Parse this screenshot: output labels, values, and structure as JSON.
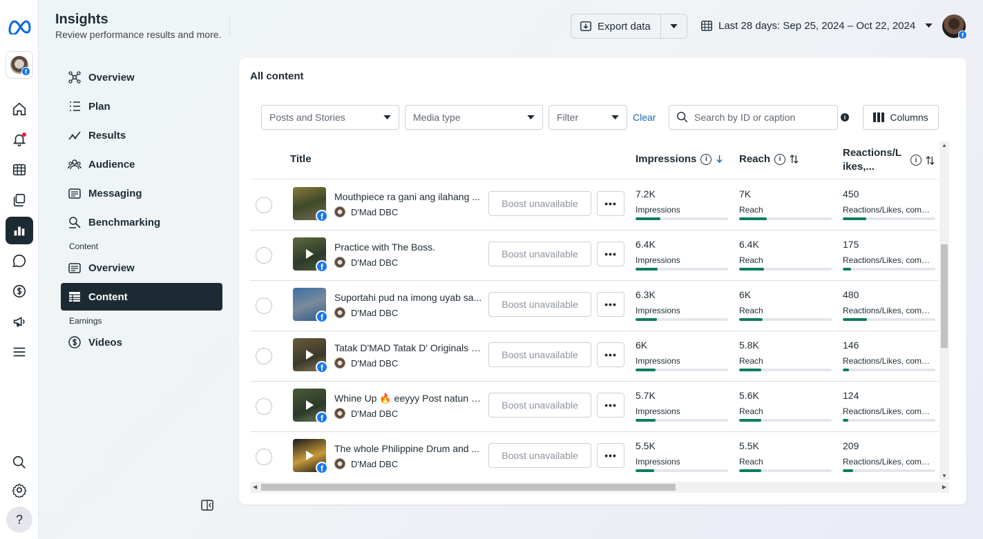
{
  "header": {
    "title": "Insights",
    "subtitle": "Review performance results and more."
  },
  "toolbar": {
    "export_label": "Export data",
    "date_range": "Last 28 days: Sep 25, 2024 – Oct 22, 2024"
  },
  "nav": {
    "items": [
      {
        "label": "Overview",
        "icon": "network-icon"
      },
      {
        "label": "Plan",
        "icon": "list-icon"
      },
      {
        "label": "Results",
        "icon": "trend-icon"
      },
      {
        "label": "Audience",
        "icon": "people-icon"
      },
      {
        "label": "Messaging",
        "icon": "messaging-icon"
      },
      {
        "label": "Benchmarking",
        "icon": "benchmark-icon"
      }
    ],
    "content_section": "Content",
    "content_items": [
      {
        "label": "Overview"
      },
      {
        "label": "Content"
      }
    ],
    "earnings_section": "Earnings",
    "earnings_items": [
      {
        "label": "Videos"
      }
    ]
  },
  "card": {
    "title": "All content",
    "filters": {
      "posts_dropdown": "Posts and Stories",
      "media_dropdown": "Media type",
      "filter_dropdown": "Filter",
      "clear": "Clear",
      "search_placeholder": "Search by ID or caption",
      "columns": "Columns"
    },
    "headers": {
      "title": "Title",
      "impressions": "Impressions",
      "reach": "Reach",
      "reactions": "Reactions/L ikes,..."
    },
    "boost_label": "Boost unavailable",
    "rows": [
      {
        "title": "Mouthpiece ra gani ang ilahang ...",
        "page": "D'Mad DBC",
        "video": false,
        "impressions": "7.2K",
        "imp_label": "Impressions",
        "imp_level": 0.27,
        "reach": "7K",
        "reach_label": "Reach",
        "reach_level": 0.3,
        "reactions": "450",
        "react_label": "Reactions/Likes, comm...",
        "react_level": 0.25
      },
      {
        "title": "Practice with The Boss.",
        "page": "D'Mad DBC",
        "video": true,
        "impressions": "6.4K",
        "imp_label": "Impressions",
        "imp_level": 0.24,
        "reach": "6.4K",
        "reach_label": "Reach",
        "reach_level": 0.27,
        "reactions": "175",
        "react_label": "Reactions/Likes, comm...",
        "react_level": 0.09
      },
      {
        "title": "Suportahi pud na imong uyab sa...",
        "page": "D'Mad DBC",
        "video": false,
        "impressions": "6.3K",
        "imp_label": "Impressions",
        "imp_level": 0.23,
        "reach": "6K",
        "reach_label": "Reach",
        "reach_level": 0.25,
        "reactions": "480",
        "react_label": "Reactions/Likes, comm...",
        "react_level": 0.26
      },
      {
        "title": "Tatak D'MAD Tatak D' Originals D...",
        "page": "D'Mad DBC",
        "video": true,
        "impressions": "6K",
        "imp_label": "Impressions",
        "imp_level": 0.22,
        "reach": "5.8K",
        "reach_label": "Reach",
        "reach_level": 0.24,
        "reactions": "146",
        "react_label": "Reactions/Likes, comm...",
        "react_level": 0.07
      },
      {
        "title": "Whine Up 🔥 eeyyy Post natun b...",
        "page": "D'Mad DBC",
        "video": true,
        "impressions": "5.7K",
        "imp_label": "Impressions",
        "imp_level": 0.22,
        "reach": "5.6K",
        "reach_label": "Reach",
        "reach_level": 0.24,
        "reactions": "124",
        "react_label": "Reactions/Likes, comm...",
        "react_level": 0.06
      },
      {
        "title": "The whole Philippine Drum and ...",
        "page": "D'Mad DBC",
        "video": true,
        "impressions": "5.5K",
        "imp_label": "Impressions",
        "imp_level": 0.2,
        "reach": "5.5K",
        "reach_label": "Reach",
        "reach_level": 0.24,
        "reactions": "209",
        "react_label": "Reactions/Likes, comm...",
        "react_level": 0.11
      }
    ]
  },
  "colors": {
    "accent": "#1c2b33",
    "link": "#1a6ab8",
    "bar": "#0a7d5e",
    "facebook": "#1877f2"
  }
}
